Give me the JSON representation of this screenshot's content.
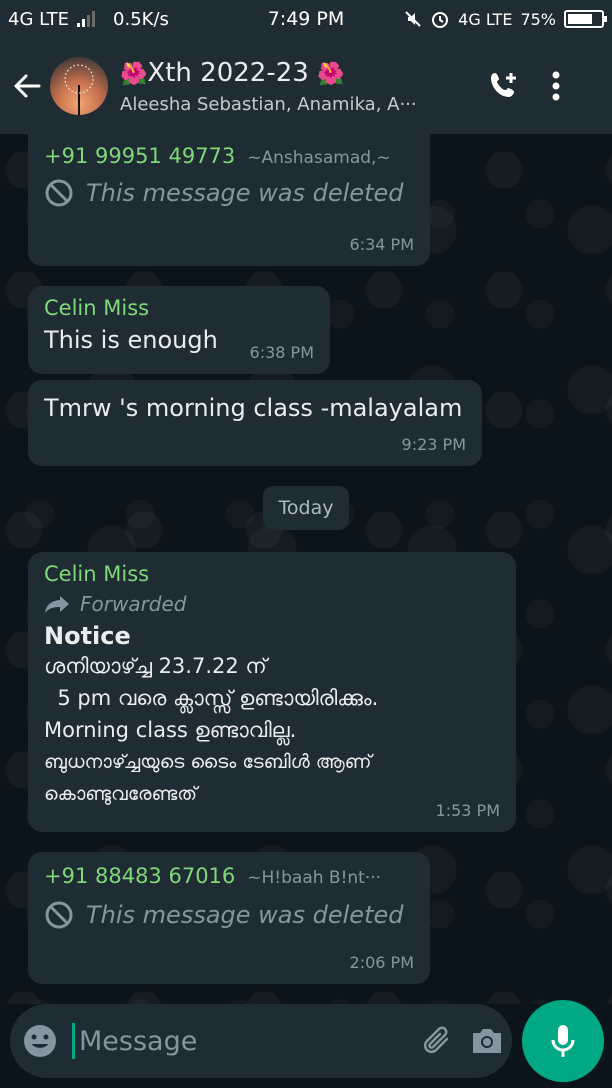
{
  "status_bar": {
    "network_left": "4G LTE",
    "speed": "0.5K/s",
    "time": "7:49 PM",
    "network_right": "4G LTE",
    "battery": "75%",
    "battery_level": 0.75
  },
  "header": {
    "flower_left": "🌺",
    "title": "Xth 2022-23",
    "flower_right": "🌺",
    "members": "Aleesha Sebastian, Anamika, A···"
  },
  "messages": [
    {
      "sender": "+91 99951 49773",
      "alias": "~Anshasamad,~",
      "text": "This message was deleted",
      "time": "6:34 PM"
    },
    {
      "sender": "Celin Miss",
      "text": "This is enough",
      "time": "6:38 PM"
    },
    {
      "text": "Tmrw 's morning class -malayalam",
      "time": "9:23 PM"
    },
    {
      "sender": "Celin Miss",
      "forwarded_label": "Forwarded",
      "notice_title": "Notice",
      "lines": [
        "ശനിയാഴ്ച്ച 23.7.22 ന്",
        "  5 pm വരെ ക്ലാസ്സ് ഉണ്ടായിരിക്കും.",
        "Morning class ഉണ്ടാവില്ല.",
        "ബുധനാഴ്ച്ചയുടെ ടൈം ടേബിൾ ആണ്",
        "കൊണ്ടുവരേണ്ടത്"
      ],
      "time": "1:53 PM"
    },
    {
      "sender": "+91 88483 67016",
      "alias": "~H!baah B!nt···",
      "text": "This message was deleted",
      "time": "2:06 PM"
    }
  ],
  "day_chip": "Today",
  "input": {
    "placeholder": "Message"
  },
  "colors": {
    "accent": "#00a884",
    "bubble": "#202c33",
    "header": "#202c33",
    "sender": "#7fd979"
  },
  "icons": [
    "back-arrow-icon",
    "add-call-icon",
    "more-vert-icon",
    "deleted-icon",
    "forward-icon",
    "emoji-icon",
    "attach-icon",
    "camera-icon",
    "mic-icon",
    "signal-icon",
    "mute-icon",
    "alarm-icon",
    "battery-icon"
  ]
}
